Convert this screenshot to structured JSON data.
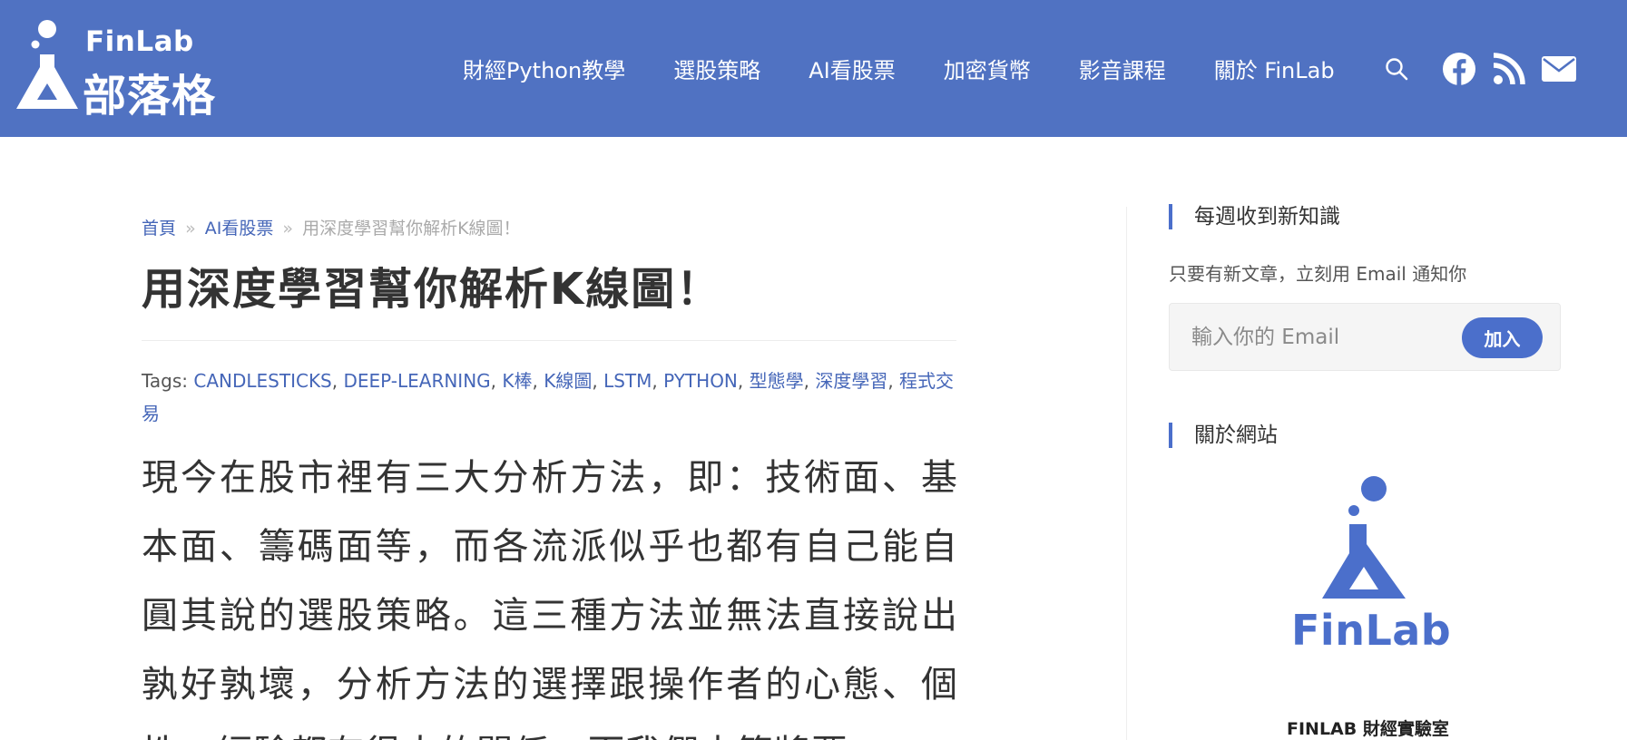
{
  "header": {
    "logo": {
      "brand": "FinLab",
      "subtitle": "部落格"
    },
    "nav": [
      {
        "label": "財經Python教學"
      },
      {
        "label": "選股策略"
      },
      {
        "label": "AI看股票"
      },
      {
        "label": "加密貨幣"
      },
      {
        "label": "影音課程"
      },
      {
        "label": "關於 FinLab"
      }
    ],
    "icons": [
      "search-icon",
      "facebook-icon",
      "rss-icon",
      "email-icon"
    ],
    "background_color": "#5072c2"
  },
  "breadcrumb": {
    "home": "首頁",
    "separator": "»",
    "category": "AI看股票",
    "current": "用深度學習幫你解析K線圖！"
  },
  "article": {
    "title": "用深度學習幫你解析K線圖！",
    "tags_label": "Tags:",
    "tags": [
      "CANDLESTICKS",
      "DEEP-LEARNING",
      "K棒",
      "K線圖",
      "LSTM",
      "PYTHON",
      "型態學",
      "深度學習",
      "程式交易"
    ],
    "body": "現今在股市裡有三大分析方法，即：技術面、基本面、籌碼面等，而各流派似乎也都有自己能自圓其說的選股策略。這三種方法並無法直接說出孰好孰壞，分析方法的選擇跟操作者的心態、個性、經驗都有很大的關係，而我們本篇將要"
  },
  "sidebar": {
    "newsletter": {
      "title": "每週收到新知識",
      "description": "只要有新文章，立刻用 Email 通知你",
      "email_placeholder": "輸入你的 Email",
      "button_label": "加入"
    },
    "about": {
      "title": "關於網站",
      "logo_text": "FinLab",
      "caption": "FINLAB 財經實驗室"
    }
  },
  "colors": {
    "accent": "#4b6fcb",
    "link": "#4566b8",
    "text": "#333333"
  }
}
